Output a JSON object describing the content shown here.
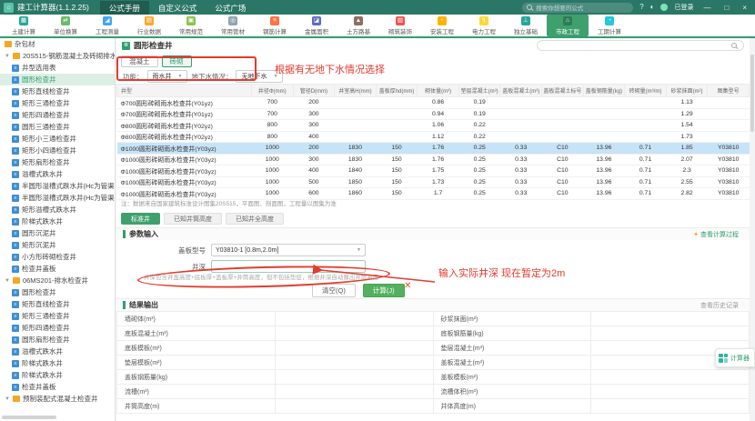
{
  "titlebar": {
    "app_title": "建工计算器(1.1.2.25)",
    "menu": [
      "公式手册",
      "自定义公式",
      "公式广场"
    ],
    "search_placeholder": "搜索你想要的公式",
    "login": "已登录",
    "window_buttons": {
      "minimize": "—",
      "maximize": "□",
      "close": "×"
    },
    "brand_color": "#2a7767"
  },
  "toolbar": {
    "items": [
      {
        "label": "土建计算",
        "icon": "calculator-icon",
        "glyph": "▦",
        "color": "#26a69a",
        "active": false
      },
      {
        "label": "单位换算",
        "icon": "unit-convert-icon",
        "glyph": "⇄",
        "color": "#66bb6a",
        "active": false
      },
      {
        "label": "工程测量",
        "icon": "ruler-icon",
        "glyph": "◢",
        "color": "#42a5f5",
        "active": false
      },
      {
        "label": "行业数据",
        "icon": "industry-data-icon",
        "glyph": "▤",
        "color": "#ffa726",
        "active": false
      },
      {
        "label": "常用规范",
        "icon": "code-book-icon",
        "glyph": "▣",
        "color": "#8bc34a",
        "active": false
      },
      {
        "label": "常用管材",
        "icon": "pipe-icon",
        "glyph": "◎",
        "color": "#90a4ae",
        "active": false
      },
      {
        "label": "钢筋计算",
        "icon": "rebar-icon",
        "glyph": "≡",
        "color": "#ff7043",
        "active": false
      },
      {
        "label": "金属面积",
        "icon": "metal-icon",
        "glyph": "◪",
        "color": "#5c6bc0",
        "active": false
      },
      {
        "label": "土方路基",
        "icon": "earthwork-icon",
        "glyph": "▲",
        "color": "#8d6e63",
        "active": false
      },
      {
        "label": "砌筑装饰",
        "icon": "brick-icon",
        "glyph": "▥",
        "color": "#ef5350",
        "active": false
      },
      {
        "label": "安装工程",
        "icon": "install-icon",
        "glyph": "+",
        "color": "#ffb300",
        "active": false
      },
      {
        "label": "电力工程",
        "icon": "power-icon",
        "glyph": "↯",
        "color": "#fdd835",
        "active": false
      },
      {
        "label": "独立基础",
        "icon": "foundation-icon",
        "glyph": "⊥",
        "color": "#26a69a",
        "active": false
      },
      {
        "label": "市政工程",
        "icon": "municipal-icon",
        "glyph": "⌂",
        "color": "#2e7d56",
        "active": true
      },
      {
        "label": "工期计算",
        "icon": "schedule-icon",
        "glyph": "◔",
        "color": "#26c6da",
        "active": false
      }
    ]
  },
  "sidebar": {
    "root_item": "杂包材",
    "groups": [
      {
        "label": "20S515-钢筋混凝土及砖砌排水检查井",
        "selected": "圆形检查井",
        "children": [
          "井型选用表",
          "圆形检查井",
          "矩形直线检查井",
          "矩形三通检查井",
          "矩形四通检查井",
          "圆形三通检查井",
          "矩形小三通检查井",
          "矩形小四通检查井",
          "矩形扇形检查井",
          "溢槽式跌水井",
          "半圆形溢槽式跌水井(Hc为管渠高)",
          "半圆形溢槽式跌水井(Hc为管渠高)",
          "矩形溢槽式跌水井",
          "阶梯式跌水井",
          "圆形沉泥井",
          "矩形沉泥井",
          "小方形砖砌检查井",
          "检查井盖板"
        ]
      },
      {
        "label": "06MS201-排水检查井",
        "selected": "",
        "children": [
          "圆形检查井",
          "矩形直线检查井",
          "矩形三通检查井",
          "矩形四通检查井",
          "圆形扇形检查井",
          "溢槽式跌水井",
          "阶梯式跌水井",
          "阶梯式跌水井",
          "检查井盖板"
        ]
      },
      {
        "label": "预制装配式混凝土检查井",
        "selected": "",
        "children": []
      }
    ]
  },
  "main": {
    "title": "圆形检查井",
    "material_tabs": [
      "混凝土",
      "砖砌"
    ],
    "material_active": 1,
    "filters": {
      "func_label": "功能：",
      "func_value": "雨水井",
      "water_label": "地下水情况：",
      "water_value": "无地下水"
    },
    "note": "注：数据来自国家建筑标准设计图集20S515，平面图、剖面图，工程量以图集为准",
    "well_tabs": [
      "标准井",
      "已知井筒高度",
      "已知井全高度"
    ],
    "well_active": 0
  },
  "catalog_table": {
    "headers": [
      "井型",
      "井径Φ(mm)",
      "管径D(mm)",
      "井室高H(mm)",
      "盖板厚hd(mm)",
      "砌体量(m³)",
      "垫层混凝土(m³)",
      "盖板混凝土(m³)",
      "盖板混凝土标号",
      "盖板钢筋量(kg)",
      "砖砌量(m³/m)",
      "砂浆抹面(m²)",
      "图集型号"
    ],
    "selected_row": 4,
    "rows": [
      [
        "Φ700圆形砖砌雨水检查井(Y01yz)",
        "700",
        "200",
        "",
        "",
        "0.86",
        "0.19",
        "",
        "",
        "",
        "",
        "1.13",
        ""
      ],
      [
        "Φ700圆形砖砌雨水检查井(Y01yz)",
        "700",
        "300",
        "",
        "",
        "0.94",
        "0.19",
        "",
        "",
        "",
        "",
        "1.29",
        ""
      ],
      [
        "Φ800圆形砖砌雨水检查井(Y02yz)",
        "800",
        "300",
        "",
        "",
        "1.06",
        "0.22",
        "",
        "",
        "",
        "",
        "1.54",
        ""
      ],
      [
        "Φ800圆形砖砌雨水检查井(Y02yz)",
        "800",
        "400",
        "",
        "",
        "1.12",
        "0.22",
        "",
        "",
        "",
        "",
        "1.73",
        ""
      ],
      [
        "Φ1000圆形砖砌雨水检查井(Y03yz)",
        "1000",
        "200",
        "1830",
        "150",
        "1.76",
        "0.25",
        "0.33",
        "C10",
        "13.96",
        "0.71",
        "1.85",
        "Y03810"
      ],
      [
        "Φ1000圆形砖砌雨水检查井(Y03yz)",
        "1000",
        "300",
        "1830",
        "150",
        "1.76",
        "0.25",
        "0.33",
        "C10",
        "13.96",
        "0.71",
        "2.07",
        "Y03810"
      ],
      [
        "Φ1000圆形砖砌雨水检查井(Y03yz)",
        "1000",
        "400",
        "1840",
        "150",
        "1.75",
        "0.25",
        "0.33",
        "C10",
        "13.96",
        "0.71",
        "2.3",
        "Y03810"
      ],
      [
        "Φ1000圆形砖砌雨水检查井(Y03yz)",
        "1000",
        "500",
        "1850",
        "150",
        "1.73",
        "0.25",
        "0.33",
        "C10",
        "13.96",
        "0.71",
        "2.55",
        "Y03810"
      ],
      [
        "Φ1000圆形砖砌雨水检查井(Y03yz)",
        "1000",
        "600",
        "1860",
        "150",
        "1.7",
        "0.25",
        "0.33",
        "C10",
        "13.96",
        "0.71",
        "2.82",
        "Y03810"
      ]
    ]
  },
  "params": {
    "title": "参数输入",
    "view_process": "查看计算过程",
    "fields": [
      {
        "label": "盖板型号",
        "value": "Y03810-1 [0.8m,2.0m]"
      },
      {
        "label": "井深",
        "value": ""
      }
    ],
    "depth_note": "井深包含井盖高度+底板厚+盖板厚+井筒高度，但不包括垫层，根据井深自动算出井筒高度",
    "clear_btn": "清空(Q)",
    "calc_btn": "计算(J)"
  },
  "results": {
    "title": "结果输出",
    "history_link": "查看历史记录",
    "rows": [
      [
        "墙砌体(m³)",
        "砂浆抹面(m²)"
      ],
      [
        "底板混凝土(m³)",
        "底板钢筋量(kg)"
      ],
      [
        "底板模板(m²)",
        "垫层混凝土(m³)"
      ],
      [
        "垫层模板(m²)",
        "盖板混凝土(m³)"
      ],
      [
        "盖板钢筋量(kg)",
        "盖板模板(m²)"
      ],
      [
        "流槽(m³)",
        "流槽体积(m³)"
      ],
      [
        "井筒高度(m)",
        "井体高度(m)"
      ]
    ]
  },
  "annotations": {
    "box_hint": "根据有无地下水情况选择",
    "depth_hint": "输入实际井深 现在暂定为2m",
    "color": "#e23b2e"
  },
  "floating": {
    "calculator_label": "计算器"
  }
}
